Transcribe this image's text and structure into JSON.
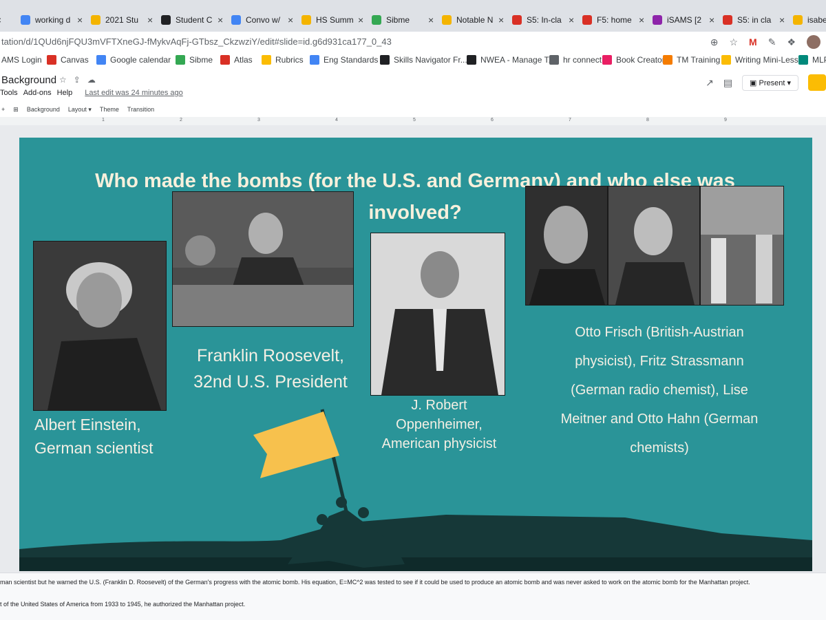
{
  "browser": {
    "tabs": [
      {
        "label": "",
        "color": "#4285f4"
      },
      {
        "label": "working d",
        "color": "#4285f4"
      },
      {
        "label": "2021 Stu",
        "color": "#f4b400"
      },
      {
        "label": "Student C",
        "color": "#202124"
      },
      {
        "label": "Convo w/",
        "color": "#4285f4"
      },
      {
        "label": "HS Summ",
        "color": "#f4b400"
      },
      {
        "label": "Sibme",
        "color": "#34a853"
      },
      {
        "label": "Notable N",
        "color": "#f4b400"
      },
      {
        "label": "S5: In-cla",
        "color": "#d93025"
      },
      {
        "label": "F5: home",
        "color": "#d93025"
      },
      {
        "label": "iSAMS [2",
        "color": "#8e24aa"
      },
      {
        "label": "S5: in cla",
        "color": "#d93025"
      },
      {
        "label": "isabella a",
        "color": "#f4b400"
      }
    ],
    "url": "tation/d/1QUd6njFQU3mVFTXneGJ-fMykvAqFj-GTbsz_CkzwziY/edit#slide=id.g6d931ca177_0_43",
    "bookmarks": [
      {
        "label": "AMS Login",
        "color": "#d93025"
      },
      {
        "label": "Canvas",
        "color": "#d93025"
      },
      {
        "label": "Google calendar",
        "color": "#4285f4"
      },
      {
        "label": "Sibme",
        "color": "#34a853"
      },
      {
        "label": "Atlas",
        "color": "#d93025"
      },
      {
        "label": "Rubrics",
        "color": "#fbbc04"
      },
      {
        "label": "Eng Standards",
        "color": "#4285f4"
      },
      {
        "label": "Skills Navigator Fr...",
        "color": "#202124"
      },
      {
        "label": "NWEA - Manage T...",
        "color": "#202124"
      },
      {
        "label": "hr connect",
        "color": "#5f6368"
      },
      {
        "label": "Book Creator",
        "color": "#e91e63"
      },
      {
        "label": "TM Training",
        "color": "#f57c00"
      },
      {
        "label": "Writing Mini-Less...",
        "color": "#fbbc04"
      },
      {
        "label": "MLP",
        "color": "#00897b"
      }
    ]
  },
  "app": {
    "title": "Background",
    "menus": [
      "Tools",
      "Add-ons",
      "Help"
    ],
    "last_edit": "Last edit was 24 minutes ago",
    "present_label": "Present",
    "toolbar": [
      "Background",
      "Layout ▾",
      "Theme",
      "Transition"
    ],
    "ruler_ticks": [
      "1",
      "2",
      "3",
      "4",
      "5",
      "6",
      "7",
      "8",
      "9"
    ]
  },
  "slide": {
    "title_line1": "Who made the bombs (for the U.S. and Germany) and who else was",
    "title_line2": "involved?",
    "captions": {
      "einstein": [
        "Albert Einstein,",
        "German scientist"
      ],
      "roosevelt": [
        "Franklin Roosevelt,",
        "32nd U.S. President"
      ],
      "oppenheimer": [
        "J. Robert",
        "Oppenheimer,",
        "American physicist"
      ],
      "others": [
        "Otto Frisch (British-Austrian",
        "physicist), Fritz Strassmann",
        "(German radio chemist), Lise",
        "Meitner  and Otto Hahn (German",
        "chemists)"
      ]
    },
    "colors": {
      "background": "#2a9498",
      "flag": "#f7c14d",
      "silhouette": "#163838"
    }
  },
  "notes": {
    "line1": "man scientist but he warned the U.S. (Franklin D. Roosevelt) of the German's progress with the atomic bomb.  His equation, E=MC^2 was tested to see if it could be used to produce an atomic bomb and was never asked to work on the atomic bomb for the Manhattan project.",
    "line2": "t of the United States of America from 1933 to 1945, he authorized the Manhattan project."
  }
}
